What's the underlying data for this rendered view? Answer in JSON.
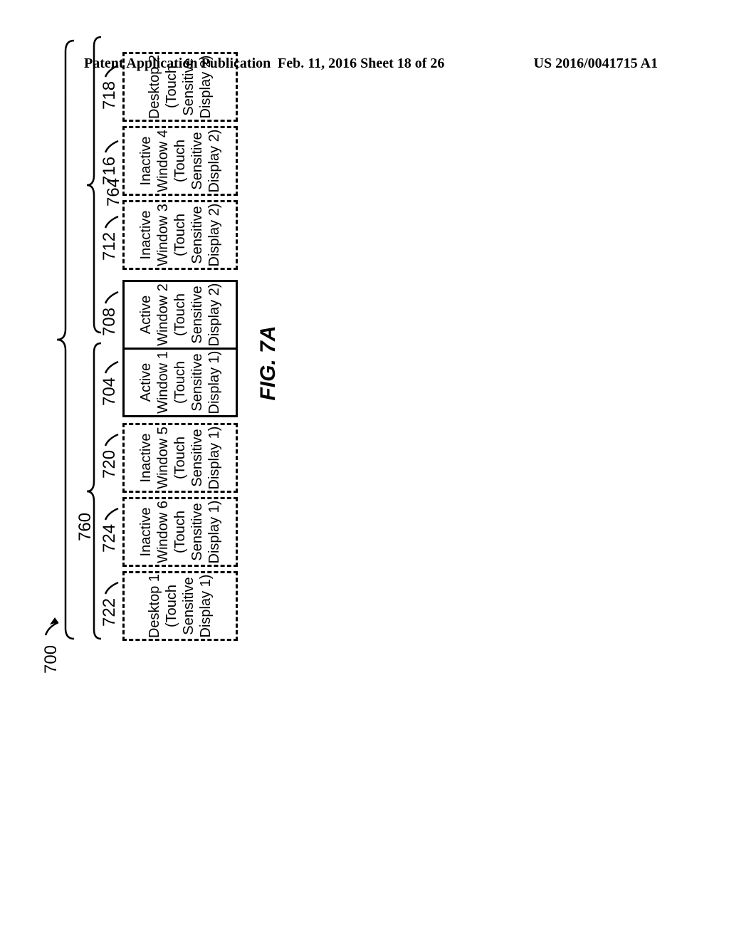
{
  "header": {
    "left": "Patent Application Publication",
    "center": "Feb. 11, 2016  Sheet 18 of 26",
    "right": "US 2016/0041715 A1"
  },
  "figure": {
    "label": "FIG. 7A",
    "ref_main": "700",
    "brace_left_ref": "760",
    "brace_right_ref": "764",
    "cards": [
      {
        "ref": "722",
        "style": "dashed",
        "lines": [
          "Desktop 1",
          "(Touch",
          "Sensitive",
          "Display 1)"
        ]
      },
      {
        "ref": "724",
        "style": "dashed",
        "lines": [
          "Inactive",
          "Window 6",
          "(Touch",
          "Sensitive",
          "Display 1)"
        ]
      },
      {
        "ref": "720",
        "style": "dashed",
        "lines": [
          "Inactive",
          "Window 5",
          "(Touch",
          "Sensitive",
          "Display 1)"
        ]
      },
      {
        "ref": "704",
        "style": "solid",
        "lines": [
          "Active",
          "Window 1",
          "(Touch",
          "Sensitive",
          "Display 1)"
        ]
      },
      {
        "ref": "708",
        "style": "solid",
        "lines": [
          "Active",
          "Window 2",
          "(Touch",
          "Sensitive",
          "Display 2)"
        ]
      },
      {
        "ref": "712",
        "style": "dashed",
        "lines": [
          "Inactive",
          "Window 3",
          "(Touch",
          "Sensitive",
          "Display 2)"
        ]
      },
      {
        "ref": "716",
        "style": "dashed",
        "lines": [
          "Inactive",
          "Window 4",
          "(Touch",
          "Sensitive",
          "Display 2)"
        ]
      },
      {
        "ref": "718",
        "style": "dashed",
        "lines": [
          "Desktop 2",
          "(Touch",
          "Sensitive",
          "Display 2)"
        ]
      }
    ]
  }
}
